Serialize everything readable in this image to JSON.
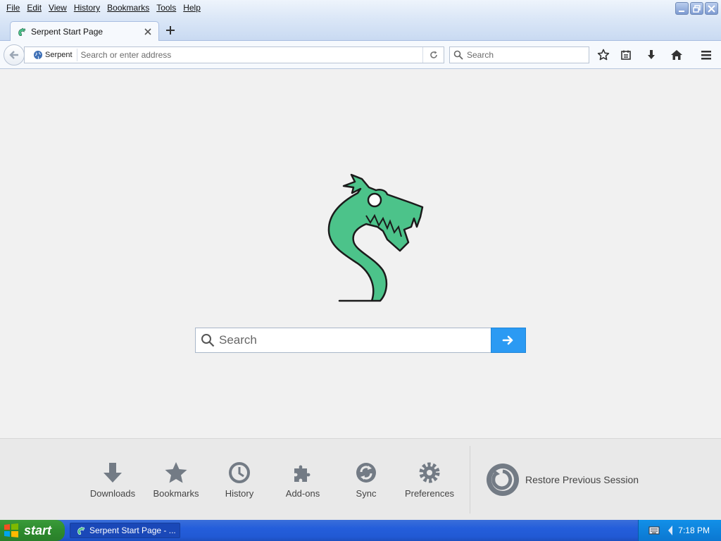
{
  "window": {
    "tab_title": "Serpent Start Page"
  },
  "menubar": [
    {
      "label": "File"
    },
    {
      "label": "Edit"
    },
    {
      "label": "View"
    },
    {
      "label": "History"
    },
    {
      "label": "Bookmarks"
    },
    {
      "label": "Tools"
    },
    {
      "label": "Help"
    }
  ],
  "navbar": {
    "identity_label": "Serpent",
    "url_placeholder": "Search or enter address",
    "search_placeholder": "Search",
    "toolbar_icons": [
      "star-icon",
      "reading-list-icon",
      "download-icon",
      "home-icon",
      "menu-icon"
    ]
  },
  "content": {
    "search_placeholder": "Search",
    "logo_color": "#4cc38a",
    "go_button_color": "#2b9af3"
  },
  "launcher": {
    "items": [
      {
        "label": "Downloads",
        "icon": "download-icon"
      },
      {
        "label": "Bookmarks",
        "icon": "star-icon"
      },
      {
        "label": "History",
        "icon": "clock-icon"
      },
      {
        "label": "Add-ons",
        "icon": "puzzle-icon"
      },
      {
        "label": "Sync",
        "icon": "sync-icon"
      },
      {
        "label": "Preferences",
        "icon": "gear-icon"
      }
    ],
    "restore_label": "Restore Previous Session"
  },
  "taskbar": {
    "start_label": "start",
    "task_label": "Serpent Start Page - ...",
    "clock": "7:18 PM"
  }
}
